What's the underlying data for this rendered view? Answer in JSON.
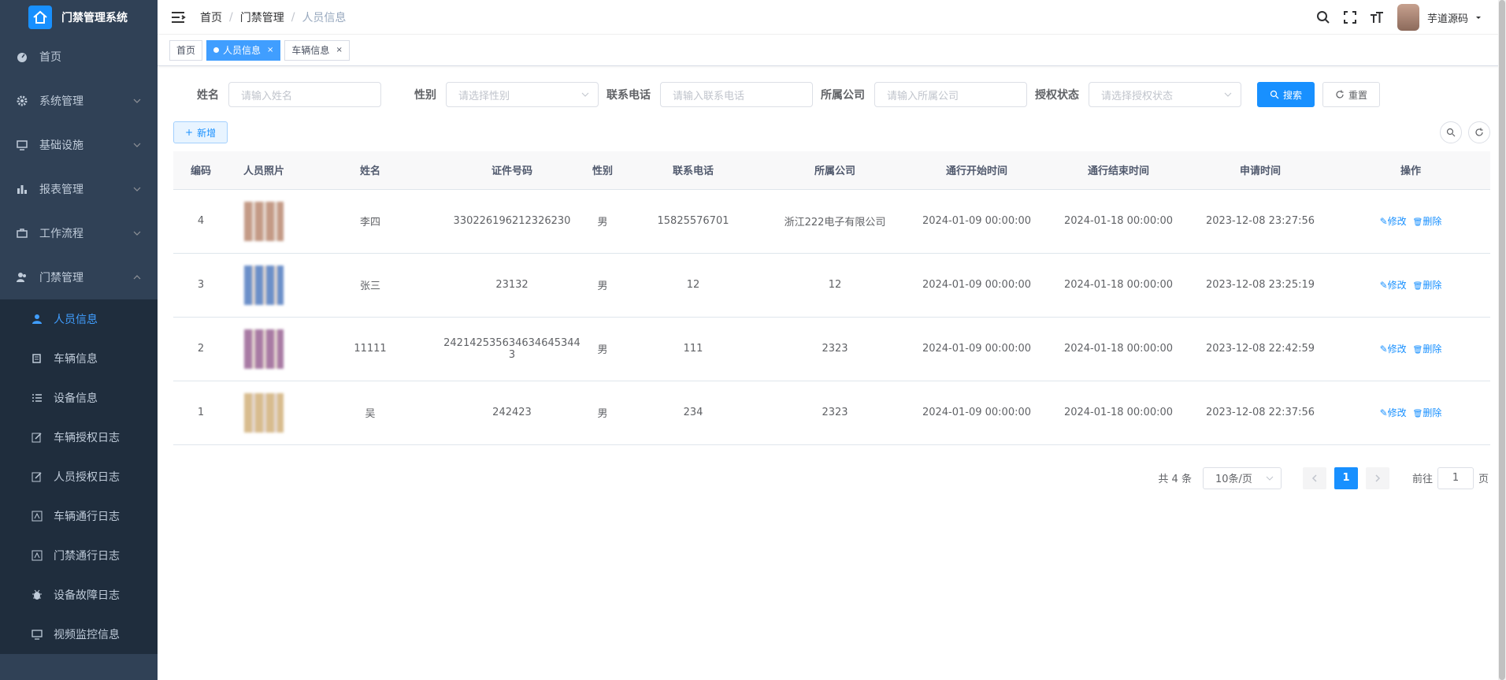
{
  "app": {
    "title": "门禁管理系统"
  },
  "sidebar": {
    "items": [
      {
        "label": "首页",
        "icon": "dashboard-icon"
      },
      {
        "label": "系统管理",
        "icon": "gear-icon"
      },
      {
        "label": "基础设施",
        "icon": "monitor-icon"
      },
      {
        "label": "报表管理",
        "icon": "chart-icon"
      },
      {
        "label": "工作流程",
        "icon": "briefcase-icon"
      },
      {
        "label": "门禁管理",
        "icon": "users-icon"
      }
    ],
    "sub_items": [
      {
        "label": "人员信息",
        "icon": "user-icon",
        "active": true
      },
      {
        "label": "车辆信息",
        "icon": "car-icon"
      },
      {
        "label": "设备信息",
        "icon": "list-icon"
      },
      {
        "label": "车辆授权日志",
        "icon": "edit-icon"
      },
      {
        "label": "人员授权日志",
        "icon": "edit-icon"
      },
      {
        "label": "车辆通行日志",
        "icon": "log-icon"
      },
      {
        "label": "门禁通行日志",
        "icon": "log-icon"
      },
      {
        "label": "设备故障日志",
        "icon": "bug-icon"
      },
      {
        "label": "视频监控信息",
        "icon": "monitor-icon"
      }
    ]
  },
  "breadcrumb": [
    "首页",
    "门禁管理",
    "人员信息"
  ],
  "header": {
    "username": "芋道源码"
  },
  "tags": [
    {
      "label": "首页",
      "active": false
    },
    {
      "label": "人员信息",
      "active": true
    },
    {
      "label": "车辆信息",
      "active": false
    }
  ],
  "search": {
    "name_label": "姓名",
    "name_placeholder": "请输入姓名",
    "gender_label": "性别",
    "gender_placeholder": "请选择性别",
    "phone_label": "联系电话",
    "phone_placeholder": "请输入联系电话",
    "company_label": "所属公司",
    "company_placeholder": "请输入所属公司",
    "auth_label": "授权状态",
    "auth_placeholder": "请选择授权状态",
    "search_button": "搜索",
    "reset_button": "重置"
  },
  "toolbar": {
    "add_button": "新增"
  },
  "table": {
    "columns": [
      "编码",
      "人员照片",
      "姓名",
      "证件号码",
      "性别",
      "联系电话",
      "所属公司",
      "通行开始时间",
      "通行结束时间",
      "申请时间",
      "操作"
    ],
    "rows": [
      {
        "id": "4",
        "name": "李四",
        "id_number": "330226196212326230",
        "gender": "男",
        "phone": "15825576701",
        "company": "浙江222电子有限公司",
        "start": "2024-01-09 00:00:00",
        "end": "2024-01-18 00:00:00",
        "applied": "2023-12-08 23:27:56",
        "photo_color": "#c49a86"
      },
      {
        "id": "3",
        "name": "张三",
        "id_number": "23132",
        "gender": "男",
        "phone": "12",
        "company": "12",
        "start": "2024-01-09 00:00:00",
        "end": "2024-01-18 00:00:00",
        "applied": "2023-12-08 23:25:19",
        "photo_color": "#6b8fc9"
      },
      {
        "id": "2",
        "name": "11111",
        "id_number": "242142535634634645344 3",
        "gender": "男",
        "phone": "111",
        "company": "2323",
        "start": "2024-01-09 00:00:00",
        "end": "2024-01-18 00:00:00",
        "applied": "2023-12-08 22:42:59",
        "photo_color": "#a87aa4"
      },
      {
        "id": "1",
        "name": "吴",
        "id_number": "242423",
        "gender": "男",
        "phone": "234",
        "company": "2323",
        "start": "2024-01-09 00:00:00",
        "end": "2024-01-18 00:00:00",
        "applied": "2023-12-08 22:37:56",
        "photo_color": "#d8bc8e"
      }
    ],
    "edit_label": "修改",
    "delete_label": "删除"
  },
  "pagination": {
    "total": "共 4 条",
    "page_size": "10条/页",
    "current_page": "1",
    "goto_label": "前往",
    "goto_value": "1",
    "page_suffix": "页"
  }
}
